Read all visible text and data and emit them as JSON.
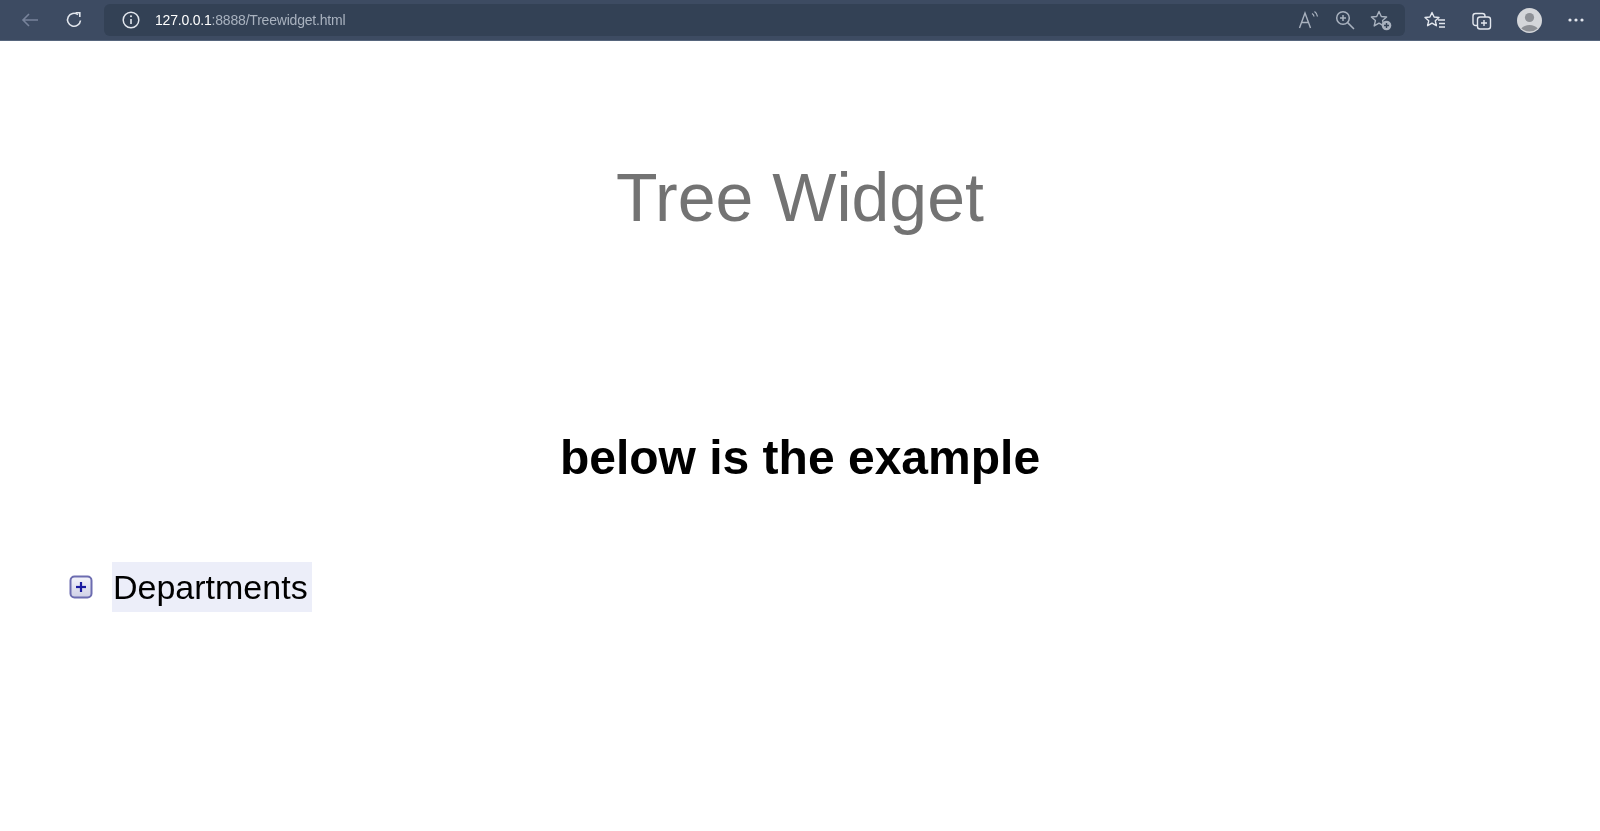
{
  "browser": {
    "url_host": "127.0.0.1",
    "url_path": ":8888/Treewidget.html"
  },
  "page": {
    "title": "Tree Widget",
    "subtitle": "below is the example"
  },
  "tree": [
    {
      "label": "Departments",
      "expanded": false,
      "selected": true
    }
  ]
}
